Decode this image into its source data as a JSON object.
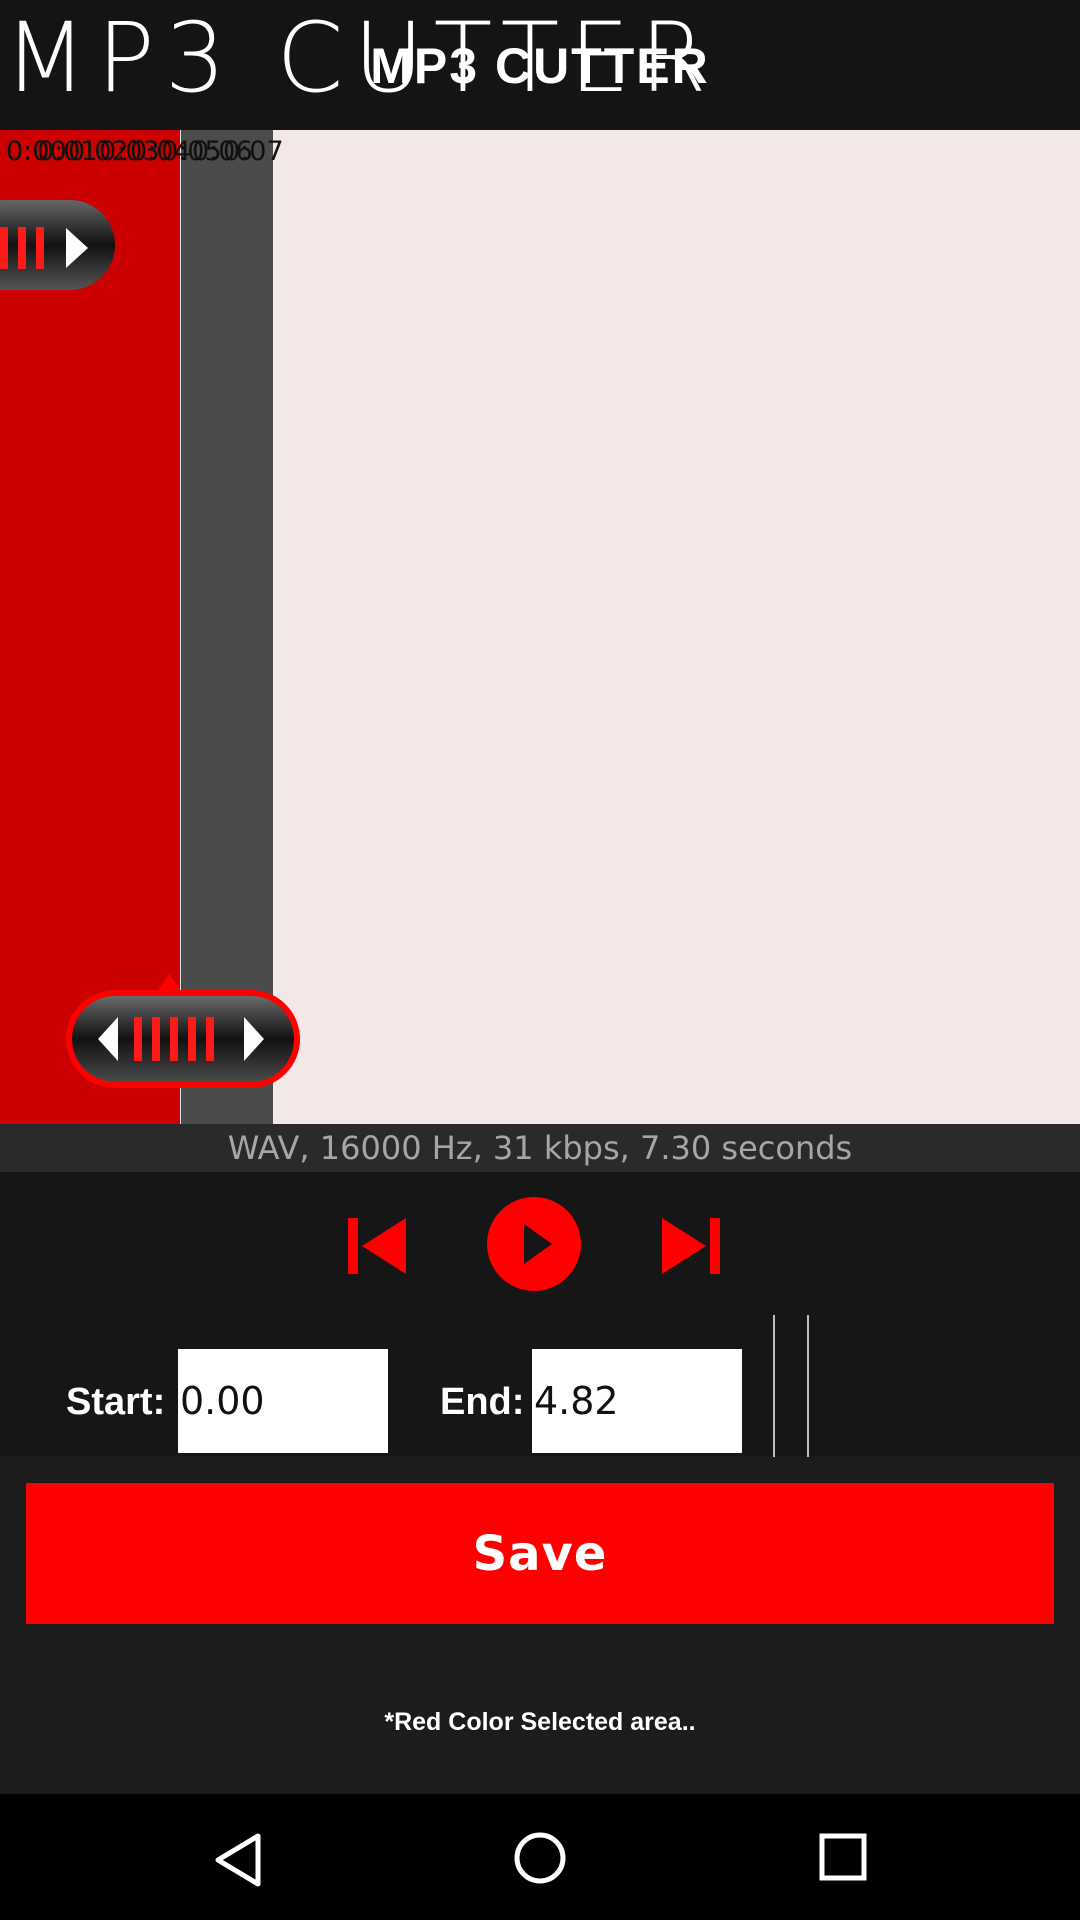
{
  "app": {
    "title": "MP3 CUTTER"
  },
  "timeline": {
    "ticks": [
      "0:00",
      "0:01",
      "0:02",
      "0:03",
      "0:04",
      "0:05",
      "0:06",
      "0:07"
    ]
  },
  "info": {
    "text": "WAV, 16000 Hz, 31 kbps, 7.30 seconds"
  },
  "icons": {
    "start_handle": "start-handle-icon",
    "end_handle": "end-handle-icon",
    "skip_back": "skip-back-icon",
    "play": "play-icon",
    "skip_forward": "skip-forward-icon",
    "nav_back": "back-triangle-icon",
    "nav_home": "home-circle-icon",
    "nav_recents": "recents-square-icon"
  },
  "fields": {
    "start_label": "Start:",
    "start_value": "0.00",
    "end_label": "End:",
    "end_value": "4.82"
  },
  "save": {
    "label": "Save"
  },
  "note": "*Red Color Selected area..",
  "colors": {
    "accent": "#ff0000",
    "selection": "#cc0000",
    "waveform_bg": "#f3e7e7",
    "toolbar": "#141414"
  }
}
